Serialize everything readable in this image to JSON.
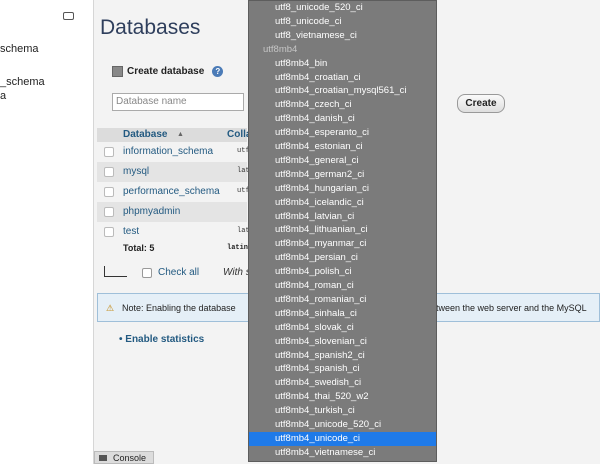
{
  "sidebar": {
    "items": [
      "schema",
      "_schema",
      "a"
    ]
  },
  "main": {
    "title": "Databases",
    "create_database_label": "Create database",
    "help_label": "?",
    "database_name_placeholder": "Database name",
    "create_button": "Create",
    "table": {
      "headers": [
        "Database",
        "Colla"
      ],
      "rows": [
        {
          "name": "information_schema",
          "collation": "utf"
        },
        {
          "name": "mysql",
          "collation": "latin"
        },
        {
          "name": "performance_schema",
          "collation": "utf"
        },
        {
          "name": "phpmyadmin",
          "collation": ""
        },
        {
          "name": "test",
          "collation": "latin"
        }
      ],
      "total_label": "Total: 5",
      "total_collation": "latin"
    },
    "check_all": "Check all",
    "with_selected": "With s",
    "note_left": "Note: Enabling the database",
    "note_right": "etween the web server and the MySQL",
    "enable_statistics": "Enable statistics",
    "console": "Console"
  },
  "dropdown": {
    "options": [
      {
        "label": "utf8_unicode_520_ci",
        "type": "option"
      },
      {
        "label": "utf8_unicode_ci",
        "type": "option"
      },
      {
        "label": "utf8_vietnamese_ci",
        "type": "option"
      },
      {
        "label": "utf8mb4",
        "type": "group"
      },
      {
        "label": "utf8mb4_bin",
        "type": "option"
      },
      {
        "label": "utf8mb4_croatian_ci",
        "type": "option"
      },
      {
        "label": "utf8mb4_croatian_mysql561_ci",
        "type": "option"
      },
      {
        "label": "utf8mb4_czech_ci",
        "type": "option"
      },
      {
        "label": "utf8mb4_danish_ci",
        "type": "option"
      },
      {
        "label": "utf8mb4_esperanto_ci",
        "type": "option"
      },
      {
        "label": "utf8mb4_estonian_ci",
        "type": "option"
      },
      {
        "label": "utf8mb4_general_ci",
        "type": "option"
      },
      {
        "label": "utf8mb4_german2_ci",
        "type": "option"
      },
      {
        "label": "utf8mb4_hungarian_ci",
        "type": "option"
      },
      {
        "label": "utf8mb4_icelandic_ci",
        "type": "option"
      },
      {
        "label": "utf8mb4_latvian_ci",
        "type": "option"
      },
      {
        "label": "utf8mb4_lithuanian_ci",
        "type": "option"
      },
      {
        "label": "utf8mb4_myanmar_ci",
        "type": "option"
      },
      {
        "label": "utf8mb4_persian_ci",
        "type": "option"
      },
      {
        "label": "utf8mb4_polish_ci",
        "type": "option"
      },
      {
        "label": "utf8mb4_roman_ci",
        "type": "option"
      },
      {
        "label": "utf8mb4_romanian_ci",
        "type": "option"
      },
      {
        "label": "utf8mb4_sinhala_ci",
        "type": "option"
      },
      {
        "label": "utf8mb4_slovak_ci",
        "type": "option"
      },
      {
        "label": "utf8mb4_slovenian_ci",
        "type": "option"
      },
      {
        "label": "utf8mb4_spanish2_ci",
        "type": "option"
      },
      {
        "label": "utf8mb4_spanish_ci",
        "type": "option"
      },
      {
        "label": "utf8mb4_swedish_ci",
        "type": "option"
      },
      {
        "label": "utf8mb4_thai_520_w2",
        "type": "option"
      },
      {
        "label": "utf8mb4_turkish_ci",
        "type": "option"
      },
      {
        "label": "utf8mb4_unicode_520_ci",
        "type": "option"
      },
      {
        "label": "utf8mb4_unicode_ci",
        "type": "option",
        "selected": true
      },
      {
        "label": "utf8mb4_vietnamese_ci",
        "type": "option"
      }
    ]
  }
}
